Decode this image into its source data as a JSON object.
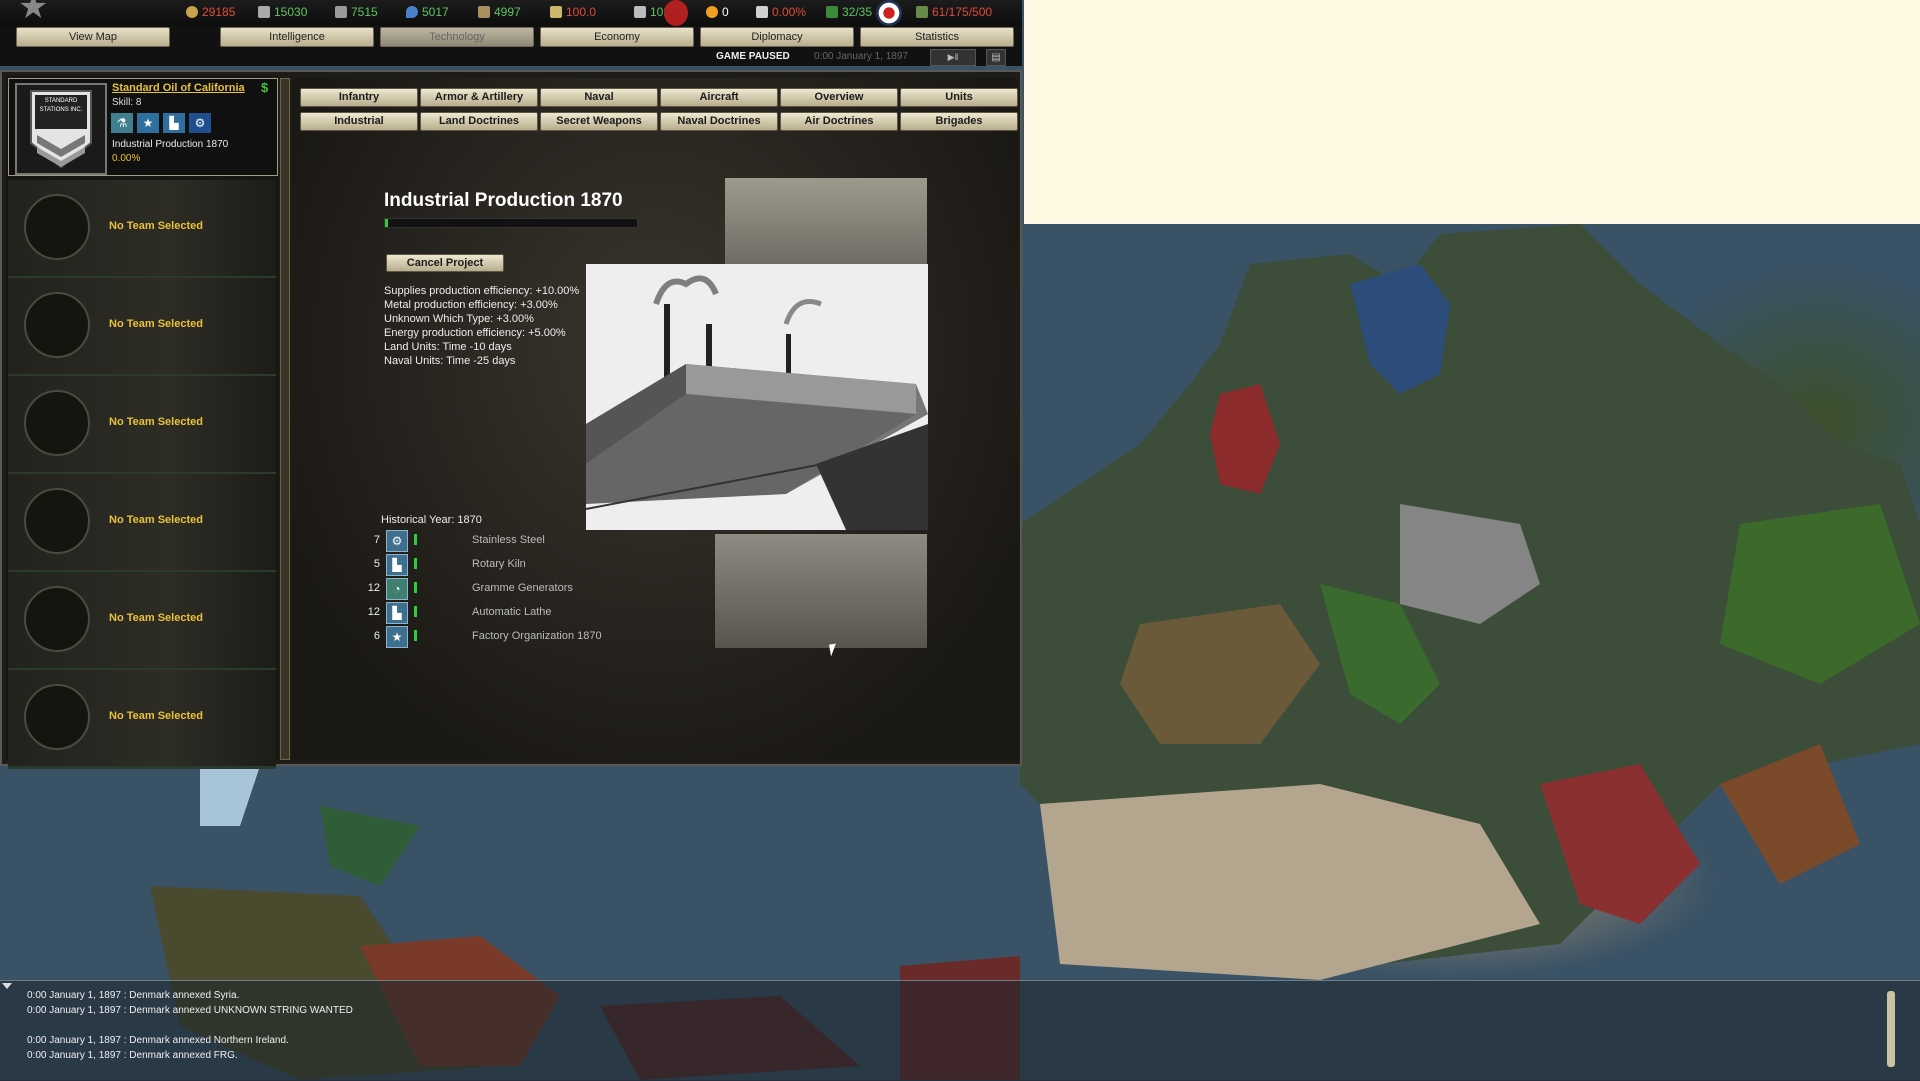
{
  "resources": [
    {
      "name": "money",
      "icon": "coin-icon",
      "value": "29185",
      "color": "#e24a3b"
    },
    {
      "name": "supplies",
      "icon": "supplies-icon",
      "value": "15030",
      "color": "#5ec45e"
    },
    {
      "name": "metal",
      "icon": "metal-icon",
      "value": "7515",
      "color": "#5ec45e"
    },
    {
      "name": "energy",
      "icon": "energy-icon",
      "value": "5017",
      "color": "#5ec45e"
    },
    {
      "name": "rare-materials",
      "icon": "crate-icon",
      "value": "4997",
      "color": "#5ec45e"
    },
    {
      "name": "dissent",
      "icon": "dissent-icon",
      "value": "100.0",
      "color": "#e24a3b"
    },
    {
      "name": "national-unity",
      "icon": "unity-icon",
      "value": "102.0",
      "color": "#5ec45e"
    },
    {
      "name": "nukes",
      "icon": "nuke-icon",
      "value": "0",
      "color": "#ffffff"
    },
    {
      "name": "dissent-pct",
      "icon": "flame-icon",
      "value": "0.00%",
      "color": "#e24a3b"
    },
    {
      "name": "officers",
      "icon": "officer-icon",
      "value": "32/35",
      "color": "#5ec45e"
    },
    {
      "name": "manpower",
      "icon": "manpower-icon",
      "value": "61/175/500",
      "color": "#e24a3b"
    }
  ],
  "tabs": {
    "view_map": "View Map",
    "intelligence": "Intelligence",
    "technology": "Technology",
    "economy": "Economy",
    "diplomacy": "Diplomacy",
    "statistics": "Statistics"
  },
  "status": {
    "game_state": "GAME PAUSED",
    "date": "0:00 January 1, 1897"
  },
  "leader": {
    "name": "Standard Oil of California",
    "skill": "Skill: 8",
    "project": "Industrial Production 1870",
    "progress": "0.00%",
    "emblem_text": "STANDARD STATIONS INC."
  },
  "team_slots": [
    "No Team Selected",
    "No Team Selected",
    "No Team Selected",
    "No Team Selected",
    "No Team Selected",
    "No Team Selected"
  ],
  "categories_row1": [
    "Infantry",
    "Armor & Artillery",
    "Naval",
    "Aircraft",
    "Overview",
    "Units"
  ],
  "categories_row2": [
    "Industrial",
    "Land Doctrines",
    "Secret Weapons",
    "Naval Doctrines",
    "Air Doctrines",
    "Brigades"
  ],
  "project": {
    "title": "Industrial Production 1870",
    "progress_fraction": 0.01,
    "cancel_label": "Cancel Project",
    "effects": [
      "Supplies production efficiency: +10.00%",
      "Metal production efficiency: +3.00%",
      "Unknown Which Type: +3.00%",
      "Energy production efficiency: +5.00%",
      "Land Units: Time -10 days",
      "Naval Units: Time -25 days"
    ],
    "historical_year": "Historical Year: 1870",
    "requirements": [
      {
        "num": "7",
        "icon": "gear-icon",
        "label": "Stainless Steel"
      },
      {
        "num": "5",
        "icon": "factory-icon",
        "label": "Rotary Kiln"
      },
      {
        "num": "12",
        "icon": "lightbulb-icon",
        "label": "Gramme Generators"
      },
      {
        "num": "12",
        "icon": "factory-icon",
        "label": "Automatic Lathe"
      },
      {
        "num": "6",
        "icon": "star-icon",
        "label": "Factory Organization 1870"
      }
    ]
  },
  "log": [
    "0:00 January 1, 1897 : Denmark annexed Syria.",
    "0:00 January 1, 1897 : Denmark annexed UNKNOWN STRING WANTED",
    "0:00 January 1, 1897 : Denmark annexed Northern Ireland.",
    "0:00 January 1, 1897 : Denmark annexed FRG."
  ]
}
